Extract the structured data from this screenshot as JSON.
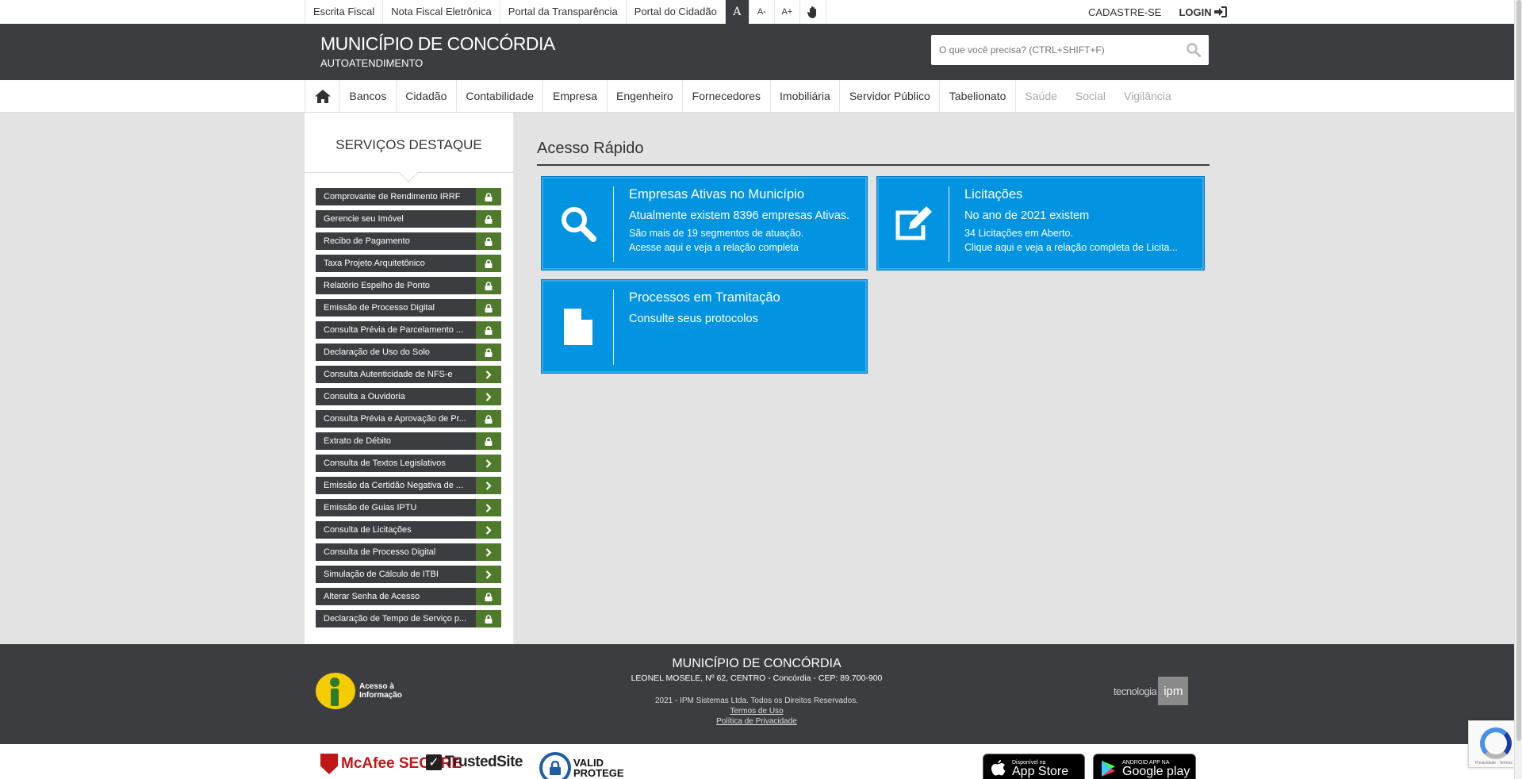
{
  "topbar": {
    "links": [
      "Escrita Fiscal",
      "Nota Fiscal Eletrônica",
      "Portal da Transparência",
      "Portal do Cidadão"
    ],
    "font_normal": "A",
    "font_decrease": "A-",
    "font_increase": "A+",
    "register": "CADASTRE-SE",
    "login": "LOGIN"
  },
  "header": {
    "title": "MUNICÍPIO DE CONCÓRDIA",
    "subtitle": "AUTOATENDIMENTO",
    "search_placeholder": "O que você precisa? (CTRL+SHIFT+F)"
  },
  "nav": {
    "items": [
      "Bancos",
      "Cidadão",
      "Contabilidade",
      "Empresa",
      "Engenheiro",
      "Fornecedores",
      "Imobiliária",
      "Servidor Público",
      "Tabelionato"
    ],
    "disabled_items": [
      "Saúde",
      "Social",
      "Vigilância"
    ]
  },
  "sidebar": {
    "title": "SERVIÇOS DESTAQUE",
    "items": [
      {
        "label": "Comprovante de Rendimento IRRF",
        "icon": "lock-icon"
      },
      {
        "label": "Gerencie seu Imóvel",
        "icon": "lock-icon"
      },
      {
        "label": "Recibo de Pagamento",
        "icon": "lock-icon"
      },
      {
        "label": "Taxa Projeto Arquitetônico",
        "icon": "lock-icon"
      },
      {
        "label": "Relatório Espelho de Ponto",
        "icon": "lock-icon"
      },
      {
        "label": "Emissão de Processo Digital",
        "icon": "lock-icon"
      },
      {
        "label": "Consulta Prévia de Parcelamento ...",
        "icon": "lock-icon"
      },
      {
        "label": "Declaração de Uso do Solo",
        "icon": "lock-icon"
      },
      {
        "label": "Consulta Autenticidade de NFS-e",
        "icon": "chevron-right-icon"
      },
      {
        "label": "Consulta a Ouvidoria",
        "icon": "chevron-right-icon"
      },
      {
        "label": "Consulta Prévia e Aprovação de Pr...",
        "icon": "lock-icon"
      },
      {
        "label": "Extrato de Débito",
        "icon": "lock-icon"
      },
      {
        "label": "Consulta de Textos Legislativos",
        "icon": "chevron-right-icon"
      },
      {
        "label": "Emissão da Certidão Negativa de ...",
        "icon": "chevron-right-icon"
      },
      {
        "label": "Emissão de Guias IPTU",
        "icon": "chevron-right-icon"
      },
      {
        "label": "Consulta de Licitações",
        "icon": "chevron-right-icon"
      },
      {
        "label": "Consulta de Processo Digital",
        "icon": "chevron-right-icon"
      },
      {
        "label": "Simulação de Cálculo de ITBI",
        "icon": "chevron-right-icon"
      },
      {
        "label": "Alterar Senha de Acesso",
        "icon": "lock-icon"
      },
      {
        "label": "Declaração de Tempo de Serviço p...",
        "icon": "lock-icon"
      }
    ]
  },
  "main": {
    "title": "Acesso Rápido",
    "cards": [
      {
        "title": "Empresas Ativas no Município",
        "lead": "Atualmente existem 8396 empresas Ativas.",
        "line1": "São mais de 19 segmentos de atuação.",
        "line2": "Acesse aqui e veja a relação completa",
        "icon": "search-icon"
      },
      {
        "title": "Licitações",
        "lead": "No ano de 2021 existem",
        "line1": "34 Licitações em Aberto.",
        "line2": "Clique aqui e veja a relação completa de Licita...",
        "icon": "edit-icon"
      },
      {
        "title": "Processos em Tramitação",
        "lead": "Consulte seus protocolos",
        "line1": "",
        "line2": "",
        "icon": "file-icon"
      }
    ]
  },
  "footer": {
    "access_info": "Acesso à Informação",
    "title": "MUNICÍPIO DE CONCÓRDIA",
    "address": "LEONEL MOSELE, Nº 62, CENTRO - Concórdia - CEP: 89.700-900",
    "copyright": "2021 - IPM Sistemas Ltda. Todos os Direitos Reservados.",
    "terms": "Termos de Uso",
    "privacy": "Política de Privacidade",
    "tech": "tecnologia",
    "ipm": "ipm"
  },
  "badges": {
    "mcafee": "McAfee SECURE",
    "trusted": "TrustedSite",
    "valid_line1": "VALID",
    "valid_line2": "PROTEGE",
    "appstore_small": "Disponível na",
    "appstore_big": "App Store",
    "gplay_small": "ANDROID APP NA",
    "gplay_big": "Google play",
    "recaptcha": "Privacidade - Termos"
  },
  "colors": {
    "header_bg": "#3c3d41",
    "card_blue": "#0293e1",
    "sidebar_icon_green": "#4f7a2b"
  }
}
